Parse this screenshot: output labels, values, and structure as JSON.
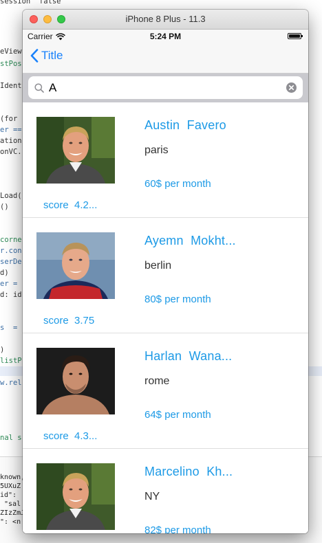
{
  "simulator": {
    "title": "iPhone 8 Plus - 11.3"
  },
  "status_bar": {
    "carrier": "Carrier",
    "time": "5:24 PM"
  },
  "nav": {
    "back_label": "Title"
  },
  "search": {
    "value": "A",
    "placeholder": ""
  },
  "cells": [
    {
      "name": "Austin  Favero",
      "city": "paris",
      "price": "60$ per month",
      "score": "score  4.2...",
      "avatar": "photo-man-blond-smiling"
    },
    {
      "name": "Ayemn  Mokht...",
      "city": "berlin",
      "price": "80$ per month",
      "score": "score  3.75",
      "avatar": "photo-man-red-shirt"
    },
    {
      "name": "Harlan  Wana...",
      "city": "rome",
      "price": "64$ per month",
      "score": "score  4.3...",
      "avatar": "photo-man-dark-hair"
    },
    {
      "name": "Marcelino  Kh...",
      "city": "NY",
      "price": "82$ per month",
      "score": "",
      "avatar": "photo-man-blond-smiling"
    }
  ],
  "colors": {
    "accent": "#1a82fb",
    "cell_text_blue": "#1d9ae6",
    "search_bar_bg": "#c9c9ce"
  },
  "background_editor": {
    "lines": [
      "session  false",
      "eView",
      "stPos",
      "Ident",
      "(for",
      "er ==",
      "ation",
      "onVC.",
      "Load(",
      "()",
      "corne",
      "r.con",
      "serDe",
      "d)",
      "er =",
      "d: id",
      "s  =",
      ")",
      "listP",
      "w.rel",
      "nal s"
    ],
    "console": [
      "known,",
      "5UXuZ",
      "id\":",
      " \"sal",
      "ZIzZmJ",
      "\": <n"
    ]
  }
}
